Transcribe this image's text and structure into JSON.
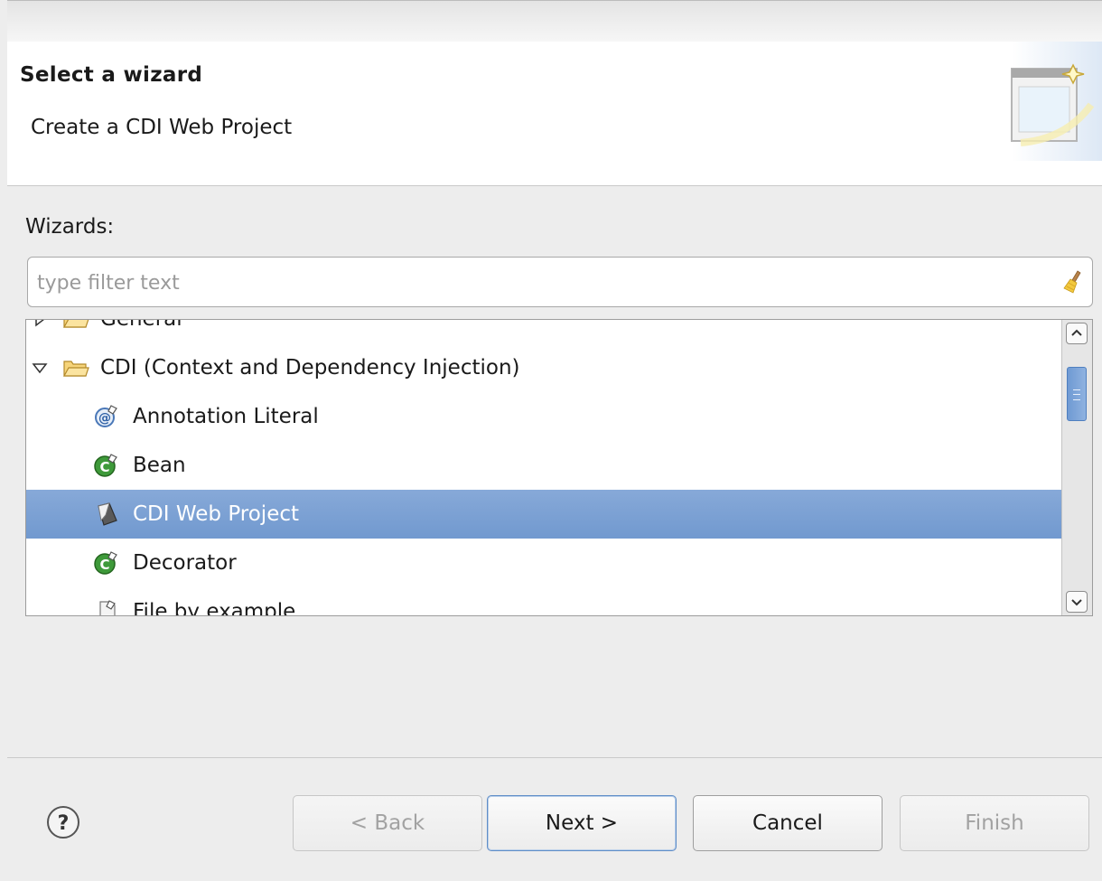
{
  "header": {
    "title": "Select a wizard",
    "description": "Create a CDI Web Project",
    "banner_icon": "new-wizard-banner-icon"
  },
  "wizards_label": "Wizards:",
  "filter": {
    "placeholder": "type filter text",
    "value": "",
    "clear_icon": "clear-broom-icon"
  },
  "tree": {
    "items": [
      {
        "label": "General",
        "level": 1,
        "expanded": false,
        "icon": "folder-icon"
      },
      {
        "label": "CDI (Context and Dependency Injection)",
        "level": 1,
        "expanded": true,
        "icon": "folder-icon"
      },
      {
        "label": "Annotation Literal",
        "level": 2,
        "icon": "annotation-literal-icon"
      },
      {
        "label": "Bean",
        "level": 2,
        "icon": "bean-class-icon"
      },
      {
        "label": "CDI Web Project",
        "level": 2,
        "icon": "cdi-project-icon",
        "selected": true
      },
      {
        "label": "Decorator",
        "level": 2,
        "icon": "decorator-class-icon"
      },
      {
        "label": "File by example",
        "level": 2,
        "icon": "file-icon"
      }
    ],
    "selection_color": "#7ca1d4"
  },
  "buttons": {
    "help_icon": "help-icon",
    "back": "< Back",
    "next": "Next >",
    "cancel": "Cancel",
    "finish": "Finish"
  }
}
